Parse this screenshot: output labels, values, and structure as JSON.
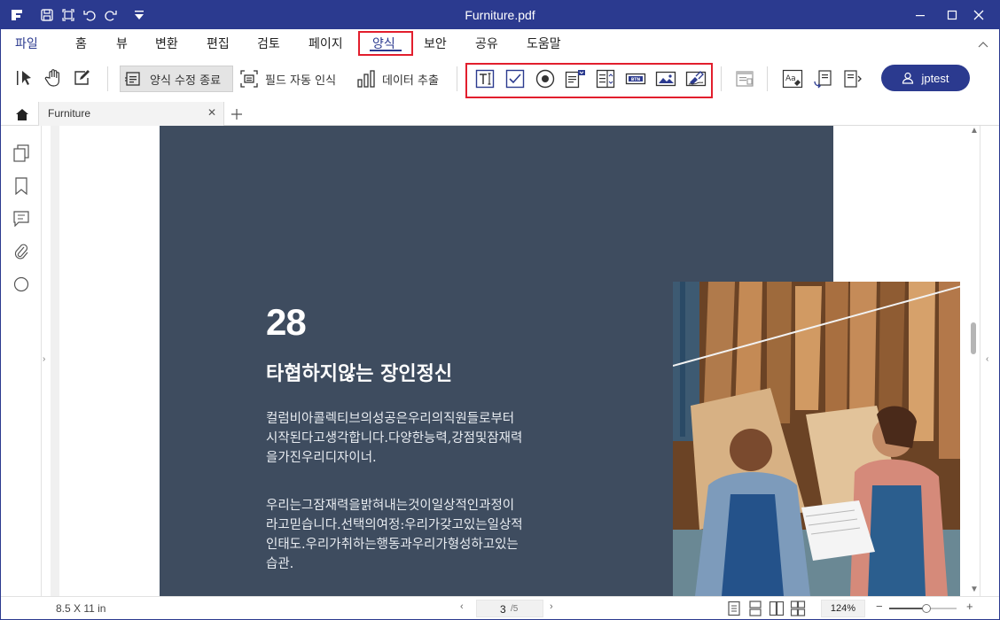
{
  "titlebar": {
    "title": "Furniture.pdf"
  },
  "menu": {
    "items": [
      "파일",
      "홈",
      "뷰",
      "변환",
      "편집",
      "검토",
      "페이지",
      "양식",
      "보안",
      "공유",
      "도움말"
    ],
    "active": "양식"
  },
  "toolbar": {
    "form_edit_done_label": "양식 수정 종료",
    "field_recognition_label": "필드 자동 인식",
    "data_extract_label": "데이터 추출",
    "field_tools": [
      "text-field-icon",
      "checkbox-icon",
      "radio-button-icon",
      "combo-box-icon",
      "list-box-icon",
      "button-field-icon",
      "image-field-icon",
      "signature-field-icon"
    ],
    "button_field_text": "BTN",
    "user_label": "jptest"
  },
  "tabs": {
    "document_tab": "Furniture"
  },
  "document": {
    "number": "28",
    "subtitle": "타협하지않는 장인정신",
    "paragraph1": "컬럼비아콜렉티브의성공은우리의직원들로부터시작된다고생각합니다.다양한능력,강점및잠재력을가진우리디자이너.",
    "paragraph2": "우리는그잠재력을밝혀내는것이일상적인과정이라고믿습니다.선택의여정:우리가갖고있는일상적인태도.우리가취하는행동과우리가형성하고있는습관."
  },
  "status": {
    "page_size": "8.5 X 11 in",
    "current_page": "3",
    "total_pages": "/5",
    "zoom": "124%",
    "zoom_level": 0.55
  },
  "colors": {
    "brand": "#2b3a8f",
    "highlight": "#e21e2d",
    "page_slate": "#3e4c5f"
  }
}
